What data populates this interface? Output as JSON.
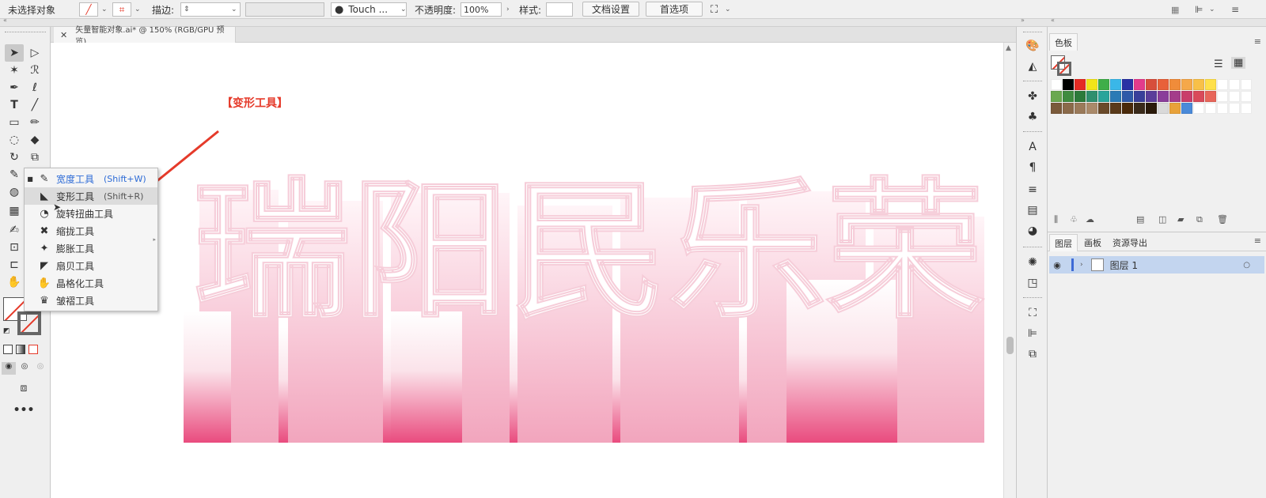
{
  "control_bar": {
    "selection_status": "未选择对象",
    "stroke_label": "描边:",
    "brush_name": "Touch ...",
    "opacity_label": "不透明度:",
    "opacity_value": "100%",
    "style_label": "样式:",
    "doc_setup": "文档设置",
    "preferences": "首选项"
  },
  "document": {
    "tab_title": "矢量智能对象.ai* @ 150% (RGB/GPU 预览)"
  },
  "canvas": {
    "annotation": "【变形工具】",
    "artwork_text": "瑞阳民乐荣"
  },
  "flyout": {
    "items": [
      {
        "name": "宽度工具",
        "shortcut": "(Shift+W)",
        "icon": "width-icon",
        "glyph": "✎"
      },
      {
        "name": "变形工具",
        "shortcut": "(Shift+R)",
        "icon": "warp-icon",
        "glyph": "◣"
      },
      {
        "name": "旋转扭曲工具",
        "shortcut": "",
        "icon": "twirl-icon",
        "glyph": "◔"
      },
      {
        "name": "缩拢工具",
        "shortcut": "",
        "icon": "pucker-icon",
        "glyph": "✖"
      },
      {
        "name": "膨胀工具",
        "shortcut": "",
        "icon": "bloat-icon",
        "glyph": "✦"
      },
      {
        "name": "扇贝工具",
        "shortcut": "",
        "icon": "scallop-icon",
        "glyph": "◤"
      },
      {
        "name": "晶格化工具",
        "shortcut": "",
        "icon": "crystallize-icon",
        "glyph": "✋"
      },
      {
        "name": "皱褶工具",
        "shortcut": "",
        "icon": "wrinkle-icon",
        "glyph": "♛"
      }
    ]
  },
  "swatches": {
    "tab": "色板",
    "colors": [
      "#ffffff",
      "#000000",
      "#e52b24",
      "#f2e519",
      "#3fae49",
      "#3ab7e8",
      "#2830a4",
      "#e33b8c",
      "#d74e3c",
      "#e8613a",
      "#f08c3a",
      "#f5a84a",
      "#f8c048",
      "#ffe04a",
      "#ffffff",
      "#ffffff",
      "#ffffff",
      "#6aa84f",
      "#3f8b3f",
      "#2c7a3a",
      "#2f8f6e",
      "#2aa49a",
      "#2a7ab5",
      "#2e5aa8",
      "#393f9a",
      "#5b3d9a",
      "#8a3d9a",
      "#a43d8a",
      "#c93d6a",
      "#d94a5a",
      "#e8665a",
      "#ffffff",
      "#ffffff",
      "#ffffff",
      "#7a5a3a",
      "#8a6a4a",
      "#9a7a5a",
      "#aa8a6a",
      "#6a4a2a",
      "#5a3a1a",
      "#4a2a0a",
      "#3a2a1a",
      "#2a1a0a",
      "#d9d9d9",
      "#e8a23a",
      "#4a8ad9",
      "#ffffff",
      "#ffffff",
      "#ffffff",
      "#ffffff",
      "#ffffff"
    ]
  },
  "layers": {
    "tabs": [
      "图层",
      "画板",
      "资源导出"
    ],
    "items": [
      {
        "name": "图层 1"
      }
    ]
  }
}
